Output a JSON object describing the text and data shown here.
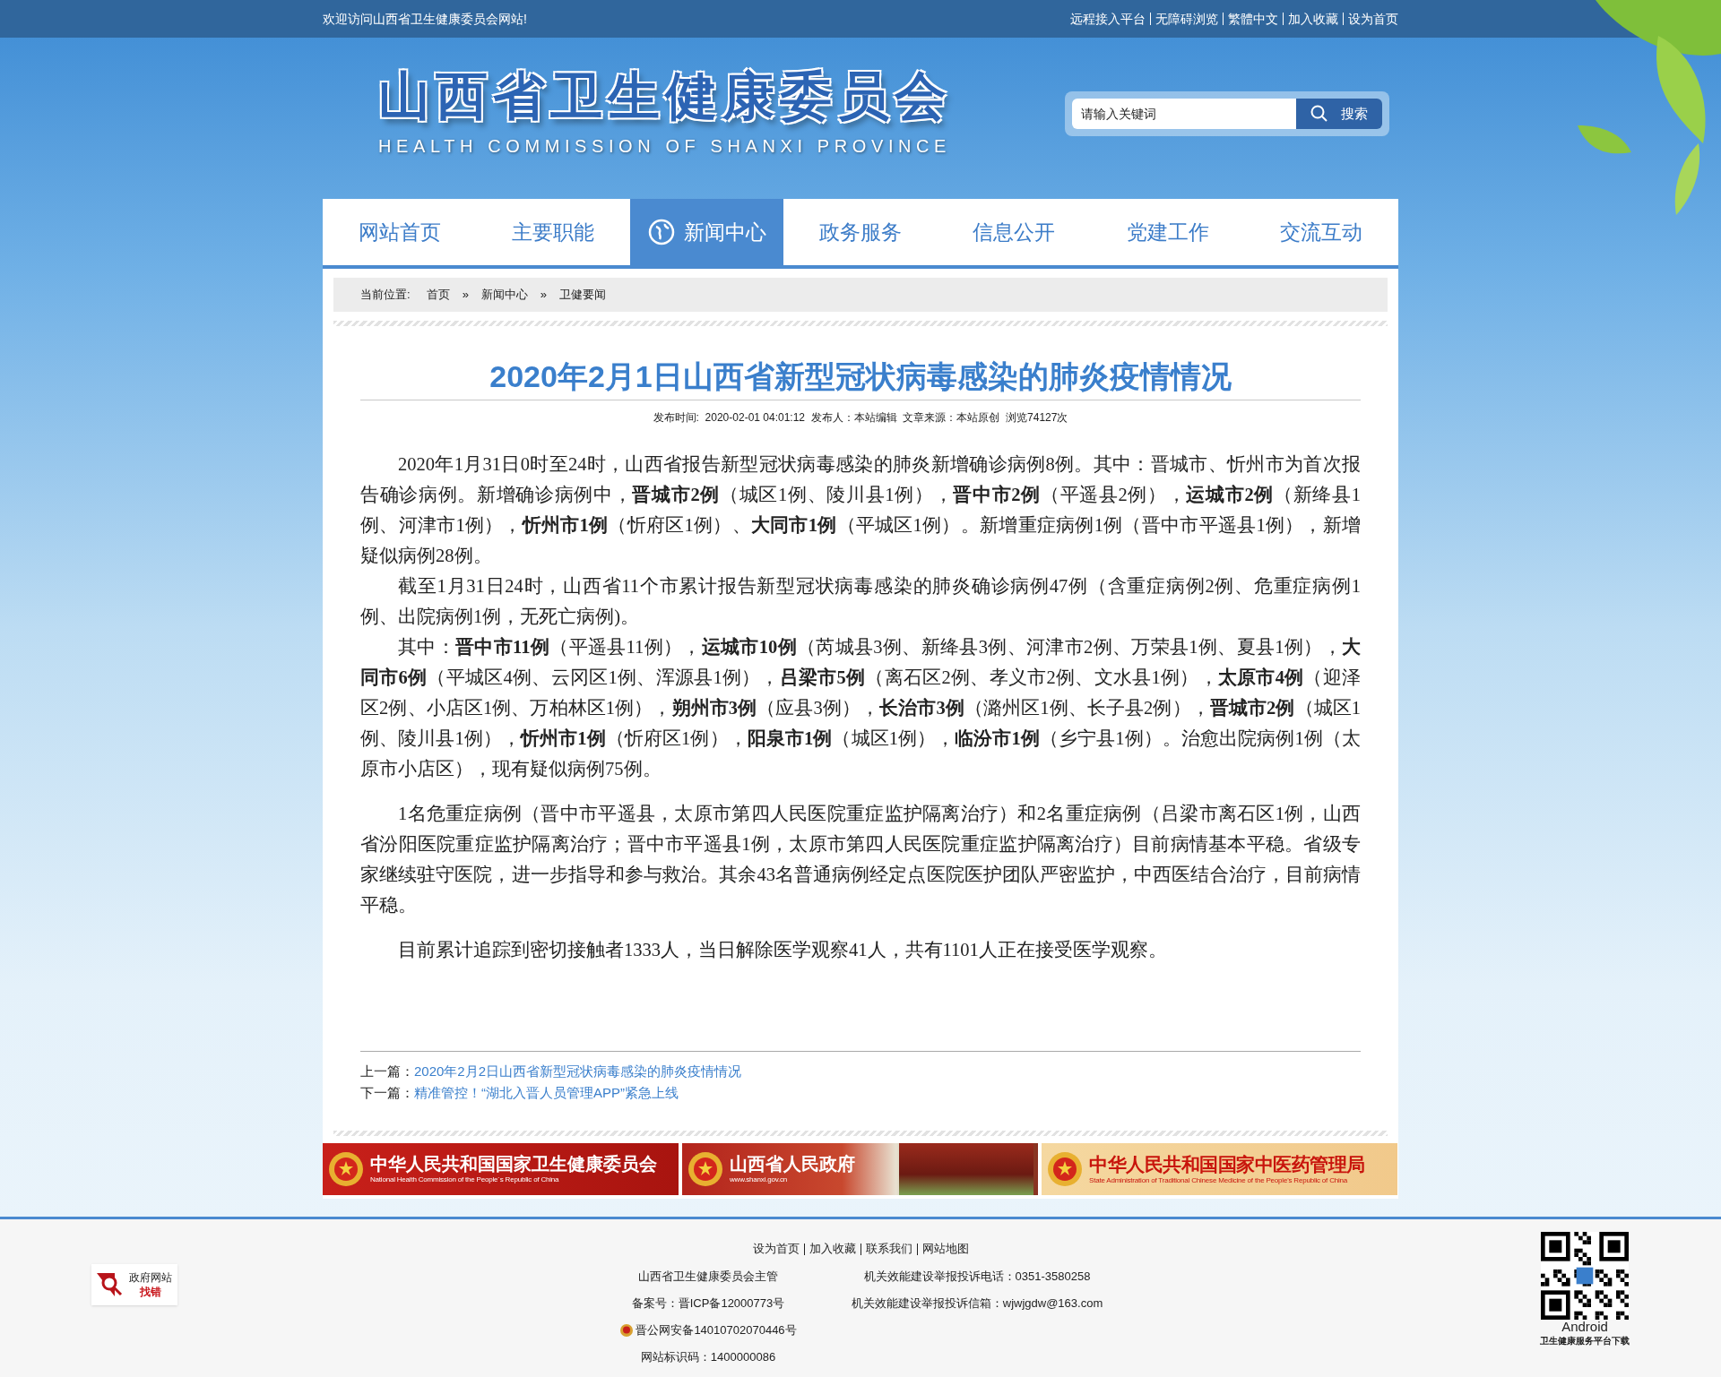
{
  "top_bar": {
    "welcome": "欢迎访问山西省卫生健康委员会网站!",
    "links": [
      "远程接入平台",
      "无障碍浏览",
      "繁體中文",
      "加入收藏",
      "设为首页"
    ]
  },
  "header": {
    "title": "山西省卫生健康委员会",
    "subtitle": "HEALTH COMMISSION OF SHANXI PROVINCE",
    "search": {
      "placeholder": "请输入关键词",
      "button": "搜索"
    }
  },
  "nav": [
    {
      "label": "网站首页",
      "selected": false
    },
    {
      "label": "主要职能",
      "selected": false
    },
    {
      "label": "新闻中心",
      "selected": true
    },
    {
      "label": "政务服务",
      "selected": false
    },
    {
      "label": "信息公开",
      "selected": false
    },
    {
      "label": "党建工作",
      "selected": false
    },
    {
      "label": "交流互动",
      "selected": false
    }
  ],
  "breadcrumb": {
    "label": "当前位置:",
    "separator": "»",
    "items": [
      "首页",
      "新闻中心",
      "卫健要闻"
    ]
  },
  "article": {
    "title": "2020年2月1日山西省新型冠状病毒感染的肺炎疫情情况",
    "meta": "发布时间:  2020-02-01 04:01:12  发布人：本站编辑  文章来源：本站原创  浏览74127次",
    "paragraph_groups": [
      [
        "2020年1月31日0时至24时，山西省报告新型冠状病毒感染的肺炎新增确诊病例8例。其中：晋城市、忻州市为首次报告确诊病例。新增确诊病例中，**晋城市2例**（城区1例、陵川县1例），**晋中市2例**（平遥县2例），**运城市2例**（新绛县1例、河津市1例），**忻州市1例**（忻府区1例）、**大同市1例**（平城区1例）。新增重症病例1例（晋中市平遥县1例），新增疑似病例28例。",
        "截至1月31日24时，山西省11个市累计报告新型冠状病毒感染的肺炎确诊病例47例（含重症病例2例、危重症病例1例、出院病例1例，无死亡病例)。",
        "其中：**晋中市11例**（平遥县11例），**运城市10例**（芮城县3例、新绛县3例、河津市2例、万荣县1例、夏县1例），**大同市6例**（平城区4例、云冈区1例、浑源县1例），**吕梁市5例**（离石区2例、孝义市2例、文水县1例），**太原市4例**（迎泽区2例、小店区1例、万柏林区1例），**朔州市3例**（应县3例），**长治市3例**（潞州区1例、长子县2例），**晋城市2例**（城区1例、陵川县1例），**忻州市1例**（忻府区1例），**阳泉市1例**（城区1例），**临汾市1例**（乡宁县1例）。治愈出院病例1例（太原市小店区），现有疑似病例75例。"
      ],
      [
        "1名危重症病例（晋中市平遥县，太原市第四人民医院重症监护隔离治疗）和2名重症病例（吕梁市离石区1例，山西省汾阳医院重症监护隔离治疗；晋中市平遥县1例，太原市第四人民医院重症监护隔离治疗）目前病情基本平稳。省级专家继续驻守医院，进一步指导和参与救治。其余43名普通病例经定点医院医护团队严密监护，中西医结合治疗，目前病情平稳。"
      ],
      [
        "目前累计追踪到密切接触者1333人，当日解除医学观察41人，共有1101人正在接受医学观察。"
      ]
    ],
    "prev": {
      "label": "上一篇：",
      "title": "2020年2月2日山西省新型冠状病毒感染的肺炎疫情情况"
    },
    "next": {
      "label": "下一篇：",
      "title": "精准管控！“湖北入晋人员管理APP”紧急上线"
    }
  },
  "banners": [
    {
      "kind": "red",
      "title": "中华人民共和国国家卫生健康委员会",
      "subtitle": "National Health Commission of the People´s Republic of China"
    },
    {
      "kind": "photo",
      "title": "山西省人民政府",
      "subtitle": "www.shanxi.gov.cn"
    },
    {
      "kind": "beige",
      "title": "中华人民共和国国家中医药管理局",
      "subtitle": "State Administration of Traditional Chinese Medicine of the People's Republic of China"
    }
  ],
  "footer": {
    "links": [
      "设为首页",
      "加入收藏",
      "联系我们",
      "网站地图"
    ],
    "rows": [
      [
        "山西省卫生健康委员会主管",
        "机关效能建设举报投诉电话：0351-3580258"
      ],
      [
        "备案号：晋ICP备12000773号",
        "机关效能建设举报投诉信箱：wjwjgdw@163.com"
      ]
    ],
    "police": "晋公网安备14010702070446号",
    "site_id": "网站标识码：1400000086",
    "badge": {
      "top": "政府网站",
      "bottom": "找错"
    },
    "qr": {
      "caption": "Android",
      "sub": "卫生健康服务平台下载"
    }
  }
}
